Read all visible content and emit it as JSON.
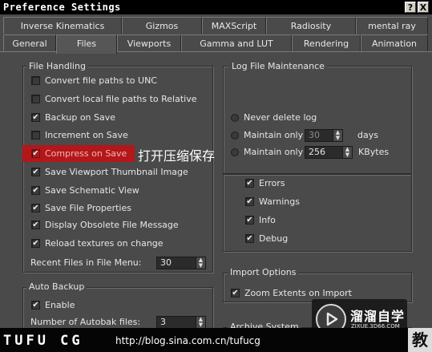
{
  "window": {
    "title": "Preference Settings",
    "help_label": "?",
    "close_label": "X"
  },
  "tabs_row1": [
    {
      "label": "Inverse Kinematics"
    },
    {
      "label": "Gizmos"
    },
    {
      "label": "MAXScript"
    },
    {
      "label": "Radiosity"
    },
    {
      "label": "mental ray"
    }
  ],
  "tabs_row2": [
    {
      "label": "General"
    },
    {
      "label": "Files"
    },
    {
      "label": "Viewports"
    },
    {
      "label": "Gamma and LUT"
    },
    {
      "label": "Rendering"
    },
    {
      "label": "Animation"
    }
  ],
  "active_tab": "Files",
  "file_handling": {
    "label": "File Handling",
    "options": [
      {
        "label": "Convert file paths to UNC",
        "checked": false
      },
      {
        "label": "Convert local file paths to Relative",
        "checked": false
      },
      {
        "label": "Backup on Save",
        "checked": true
      },
      {
        "label": "Increment on Save",
        "checked": false
      },
      {
        "label": "Compress on Save",
        "checked": true
      },
      {
        "label": "Save Viewport Thumbnail Image",
        "checked": true
      },
      {
        "label": "Save Schematic View",
        "checked": true
      },
      {
        "label": "Save File Properties",
        "checked": true
      },
      {
        "label": "Display Obsolete File Message",
        "checked": true
      },
      {
        "label": "Reload textures on change",
        "checked": true
      }
    ],
    "recent_files_label": "Recent Files in File Menu:",
    "recent_files_value": "30"
  },
  "annotation": "打开压缩保存",
  "log_file": {
    "label": "Log File Maintenance",
    "never_delete_label": "Never delete log",
    "maintain_days_label": "Maintain only",
    "maintain_days_value": "30",
    "days_unit": "days",
    "maintain_kb_label": "Maintain only",
    "maintain_kb_value": "256",
    "kb_unit": "KBytes",
    "levels": [
      {
        "label": "Errors",
        "checked": true
      },
      {
        "label": "Warnings",
        "checked": true
      },
      {
        "label": "Info",
        "checked": true
      },
      {
        "label": "Debug",
        "checked": true
      }
    ]
  },
  "import_options": {
    "label": "Import Options",
    "zoom_extents_label": "Zoom Extents on Import",
    "zoom_extents_checked": true
  },
  "auto_backup": {
    "label": "Auto Backup",
    "enable_label": "Enable",
    "enable_checked": true,
    "num_files_label": "Number of Autobak files:",
    "num_files_value": "3"
  },
  "archive_system": {
    "label": "Archive System"
  },
  "footer": {
    "brand": "TUFU CG",
    "url": "http://blog.sina.com.cn/tufucg",
    "badge": "教"
  },
  "watermark": {
    "name": "溜溜自学",
    "sub": "ZIXUE.3D66.COM"
  },
  "colors": {
    "background": "#4a4a4a",
    "highlight": "#b3171a",
    "titlebar": "#000000"
  }
}
